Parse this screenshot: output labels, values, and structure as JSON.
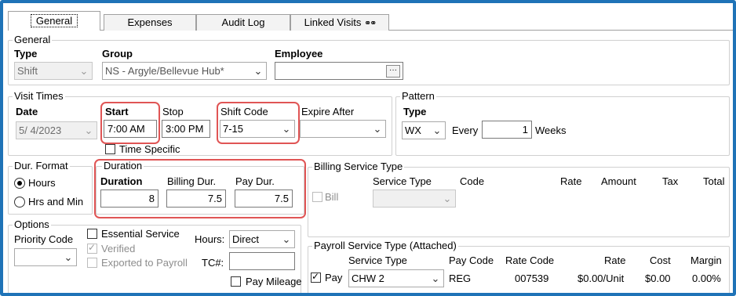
{
  "tabs": [
    {
      "label": "General"
    },
    {
      "label": "Expenses"
    },
    {
      "label": "Audit Log"
    },
    {
      "label": "Linked Visits"
    }
  ],
  "general": {
    "title": "General",
    "type_label": "Type",
    "type_value": "Shift",
    "group_label": "Group",
    "group_value": "NS - Argyle/Bellevue Hub*",
    "employee_label": "Employee",
    "employee_value": "",
    "employee_button": "···"
  },
  "visit_times": {
    "title": "Visit Times",
    "date_label": "Date",
    "date_value": "5/  4/2023",
    "start_label": "Start",
    "start_value": "7:00 AM",
    "stop_label": "Stop",
    "stop_value": "3:00 PM",
    "shift_code_label": "Shift Code",
    "shift_code_value": "7-15",
    "expire_after_label": "Expire After",
    "expire_after_value": "",
    "time_specific_label": "Time Specific"
  },
  "pattern": {
    "title": "Pattern",
    "type_label": "Type",
    "type_value": "WX",
    "every_label": "Every",
    "every_value": "1",
    "unit_label": "Weeks"
  },
  "dur_format": {
    "title": "Dur. Format",
    "option_hours": "Hours",
    "option_hrs_min": "Hrs and Min",
    "selected": "Hours"
  },
  "duration": {
    "title": "Duration",
    "duration_label": "Duration",
    "duration_value": "8",
    "billing_label": "Billing Dur.",
    "billing_value": "7.5",
    "pay_label": "Pay Dur.",
    "pay_value": "7.5"
  },
  "billing_service": {
    "title": "Billing Service Type",
    "bill_label": "Bill",
    "headers": [
      "Service Type",
      "Code",
      "Rate",
      "Amount",
      "Tax",
      "Total"
    ],
    "service_type_value": ""
  },
  "options": {
    "title": "Options",
    "priority_code_label": "Priority Code",
    "priority_code_value": "",
    "essential_service_label": "Essential Service",
    "verified_label": "Verified",
    "exported_label": "Exported to Payroll",
    "hours_label": "Hours:",
    "hours_value": "Direct",
    "tc_label": "TC#:",
    "tc_value": "",
    "pay_mileage_label": "Pay Mileage"
  },
  "payroll_service": {
    "title": "Payroll Service Type (Attached)",
    "headers": [
      "Service Type",
      "Pay Code",
      "Rate Code",
      "Rate",
      "Cost",
      "Margin"
    ],
    "pay_label": "Pay",
    "pay_checked": true,
    "row": {
      "service_type": "CHW 2",
      "pay_code": "REG",
      "rate_code": "007539",
      "rate": "$0.00/Unit",
      "cost": "$0.00",
      "margin": "0.00%"
    }
  },
  "colors": {
    "frame_border": "#1f73b7",
    "highlight": "#e05555"
  }
}
